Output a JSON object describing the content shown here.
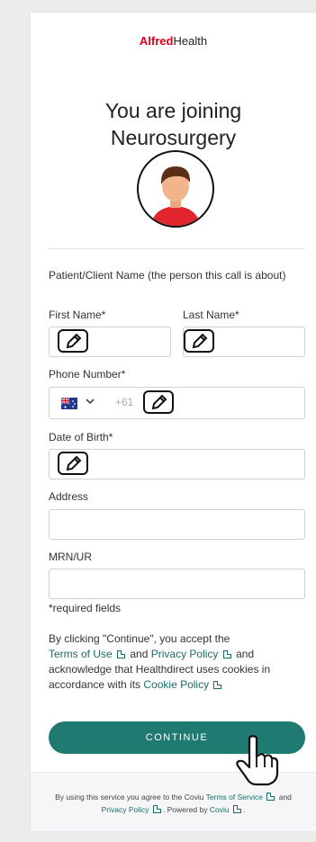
{
  "brand": {
    "part1": "Alfred",
    "part2": "Health"
  },
  "title": {
    "line1": "You are joining",
    "line2": "Neurosurgery"
  },
  "section_label": "Patient/Client Name (the person this call is about)",
  "fields": {
    "first_name_label": "First Name*",
    "last_name_label": "Last Name*",
    "phone_label": "Phone Number*",
    "phone_prefix": "+61",
    "dob_label": "Date of Birth*",
    "address_label": "Address",
    "mrn_label": "MRN/UR",
    "required_note": "*required fields"
  },
  "consent": {
    "t1": "By clicking \"Continue\", you accept the",
    "terms": "Terms of Use",
    "and1": "and",
    "privacy": "Privacy Policy",
    "t2": "and",
    "t3": "acknowledge that Healthdirect uses cookies in",
    "t4": "accordance with its",
    "cookie": "Cookie Policy"
  },
  "continue_label": "CONTINUE",
  "footer": {
    "t1": "By using this service you agree to the Coviu",
    "tos": "Terms of Service",
    "and": "and",
    "privacy": "Privacy Policy",
    "powered": ". Powered by",
    "coviu": "Coviu",
    "end": "."
  },
  "colors": {
    "accent": "#1f7a72",
    "brand_red": "#e2001a"
  },
  "icons": [
    "edit-icon",
    "australia-flag-icon",
    "chevron-down-icon",
    "external-link-icon",
    "hand-pointer-icon"
  ]
}
